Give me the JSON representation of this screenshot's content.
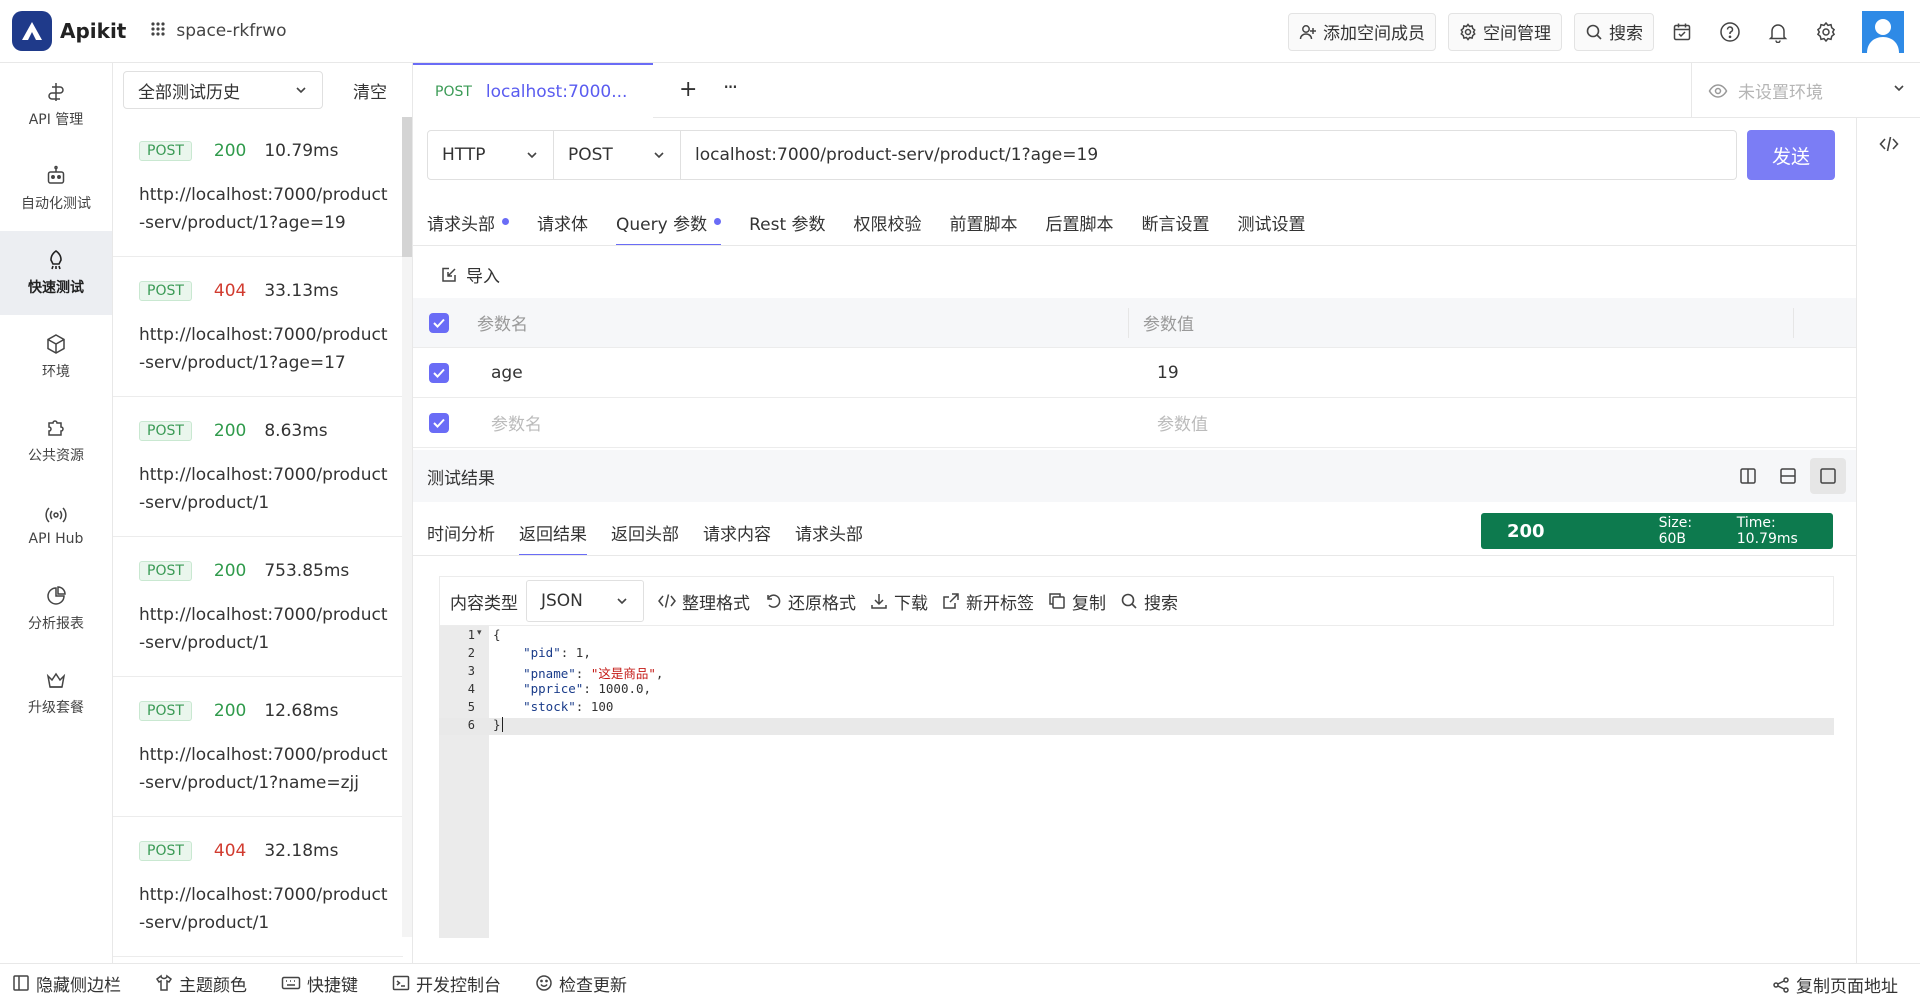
{
  "app": {
    "name": "Apikit",
    "space": "space-rkfrwo",
    "brand_color": "#1f3a8a",
    "accent_color": "#6a6cf6"
  },
  "topbar": {
    "add_member": "添加空间成员",
    "space_manage": "空间管理",
    "search": "搜索"
  },
  "rail": {
    "items": [
      {
        "label": "API 管理",
        "icon": "api-icon"
      },
      {
        "label": "自动化测试",
        "icon": "robot-icon"
      },
      {
        "label": "快速测试",
        "icon": "rocket-icon"
      },
      {
        "label": "环境",
        "icon": "cube-icon"
      },
      {
        "label": "公共资源",
        "icon": "puzzle-icon"
      },
      {
        "label": "API Hub",
        "icon": "signal-icon"
      },
      {
        "label": "分析报表",
        "icon": "pie-chart-icon"
      },
      {
        "label": "升级套餐",
        "icon": "crown-icon"
      }
    ]
  },
  "history": {
    "filter": "全部测试历史",
    "clear": "清空",
    "items": [
      {
        "method": "POST",
        "code": "200",
        "time": "10.79ms",
        "url": "http://localhost:7000/product-serv/product/1?age=19"
      },
      {
        "method": "POST",
        "code": "404",
        "time": "33.13ms",
        "url": "http://localhost:7000/product-serv/product/1?age=17"
      },
      {
        "method": "POST",
        "code": "200",
        "time": "8.63ms",
        "url": "http://localhost:7000/product-serv/product/1"
      },
      {
        "method": "POST",
        "code": "200",
        "time": "753.85ms",
        "url": "http://localhost:7000/product-serv/product/1"
      },
      {
        "method": "POST",
        "code": "200",
        "time": "12.68ms",
        "url": "http://localhost:7000/product-serv/product/1?name=zjj"
      },
      {
        "method": "POST",
        "code": "404",
        "time": "32.18ms",
        "url": "http://localhost:7000/product-serv/product/1"
      }
    ]
  },
  "tab": {
    "method": "POST",
    "title": "localhost:7000..."
  },
  "env": {
    "placeholder": "未设置环境"
  },
  "request": {
    "protocol": "HTTP",
    "method": "POST",
    "url": "localhost:7000/product-serv/product/1?age=19",
    "send": "发送"
  },
  "subtabs": [
    "请求头部",
    "请求体",
    "Query 参数",
    "Rest 参数",
    "权限校验",
    "前置脚本",
    "后置脚本",
    "断言设置",
    "测试设置"
  ],
  "import_label": "导入",
  "params": {
    "col_name": "参数名",
    "col_value": "参数值",
    "rows": [
      {
        "name": "age",
        "value": "19"
      }
    ],
    "placeholder_name": "参数名",
    "placeholder_value": "参数值"
  },
  "result": {
    "title": "测试结果",
    "tabs": [
      "时间分析",
      "返回结果",
      "返回头部",
      "请求内容",
      "请求头部"
    ],
    "status_code": "200",
    "size": "Size: 60B",
    "time": "Time: 10.79ms",
    "status_color": "#0d7a4e"
  },
  "content_toolbar": {
    "type_label": "内容类型",
    "type": "JSON",
    "format": "整理格式",
    "restore": "还原格式",
    "download": "下载",
    "new_tab": "新开标签",
    "copy": "复制",
    "search": "搜索"
  },
  "code": {
    "line_numbers": [
      "1",
      "2",
      "3",
      "4",
      "5",
      "6"
    ],
    "open": "{",
    "l2k": "\"pid\"",
    "l2v": ": 1,",
    "l3k": "\"pname\"",
    "l3s": "\"这是商品\"",
    "l3e": ",",
    "l4k": "\"pprice\"",
    "l4v": ": 1000.0,",
    "l5k": "\"stock\"",
    "l5v": ": 100",
    "close": "}"
  },
  "footer": {
    "hide_sidebar": "隐藏侧边栏",
    "theme": "主题颜色",
    "shortcuts": "快捷键",
    "devtools": "开发控制台",
    "update": "检查更新",
    "copy_url": "复制页面地址"
  }
}
